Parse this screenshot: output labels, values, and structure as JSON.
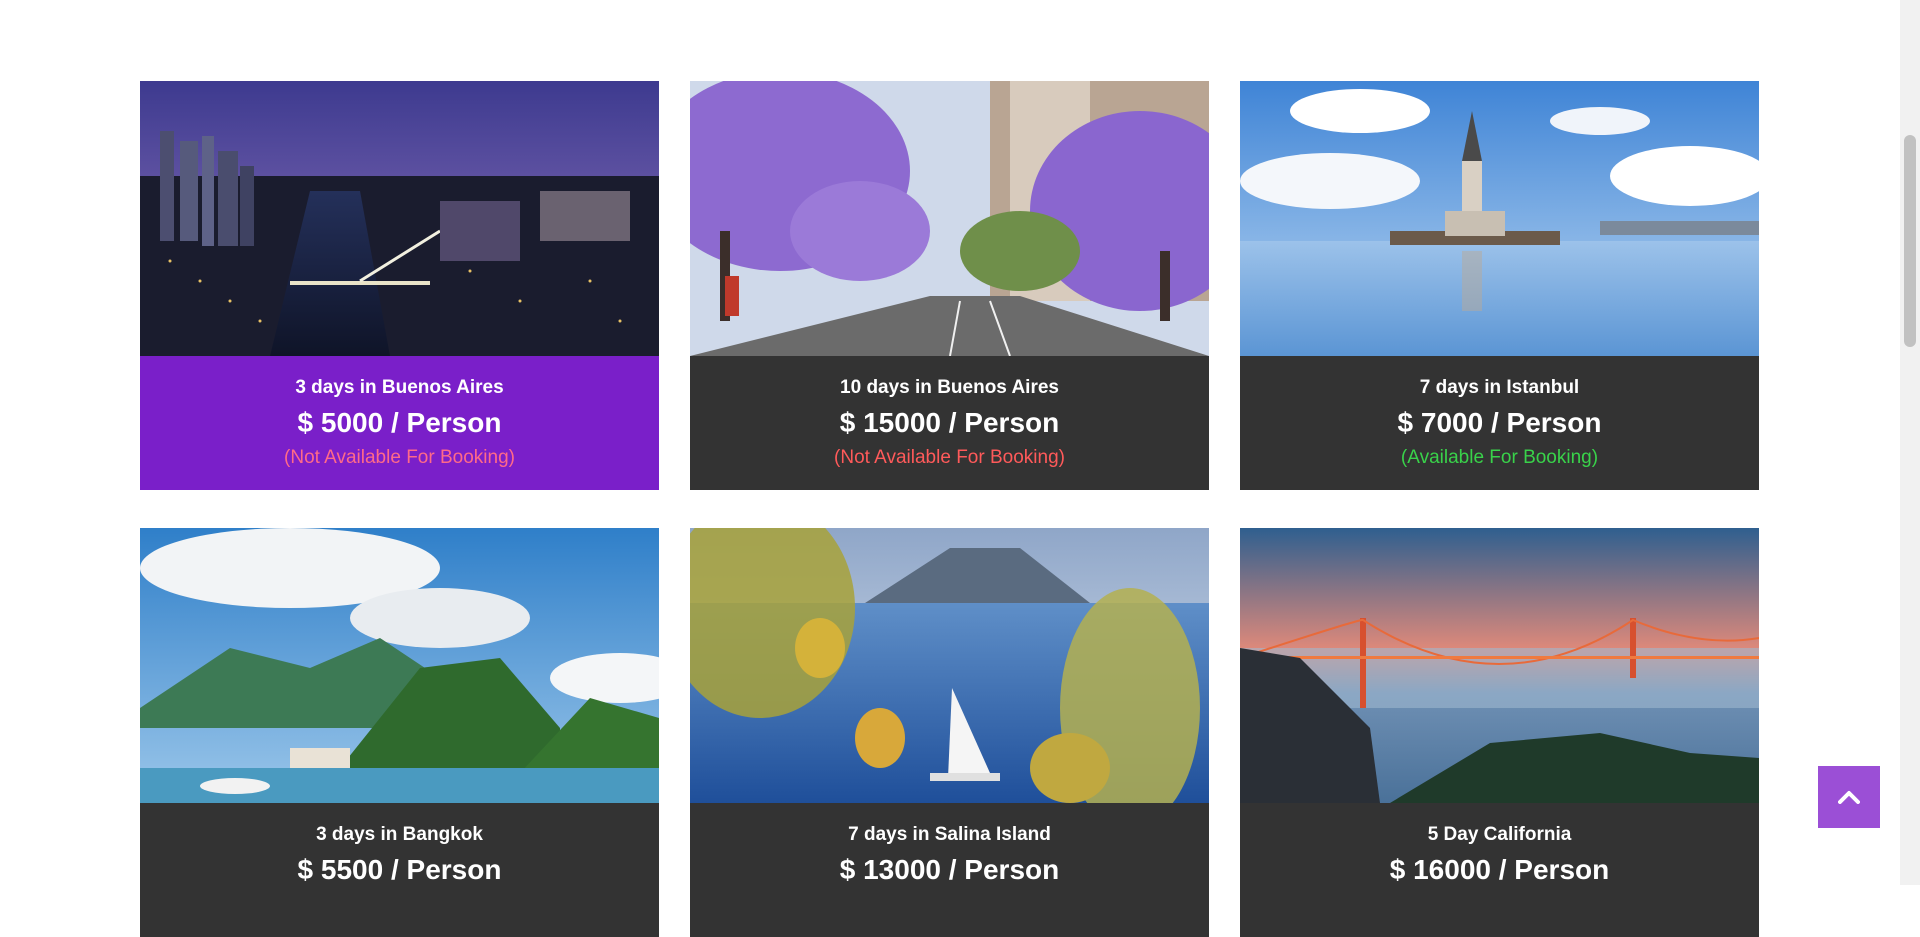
{
  "tours": [
    {
      "title": "3 days in Buenos Aires",
      "price": "$ 5000 / Person",
      "status": "(Not Available For Booking)"
    },
    {
      "title": "10 days in Buenos Aires",
      "price": "$ 15000 / Person",
      "status": "(Not Available For Booking)"
    },
    {
      "title": "7 days in Istanbul",
      "price": "$ 7000 / Person",
      "status": "(Available For Booking)"
    },
    {
      "title": "3 days in Bangkok",
      "price": "$ 5500 / Person",
      "status": ""
    },
    {
      "title": "7 days in Salina Island",
      "price": "$ 13000 / Person",
      "status": ""
    },
    {
      "title": "5 Day California",
      "price": "$ 16000 / Person",
      "status": ""
    }
  ],
  "colors": {
    "accent": "#7a1fc9",
    "card_bg": "#333333",
    "unavailable": "#ff5a5a",
    "available": "#39d24a",
    "scroll_top_button": "#9b4fd6"
  },
  "icons": {
    "scroll_top": "chevron-up-icon"
  }
}
